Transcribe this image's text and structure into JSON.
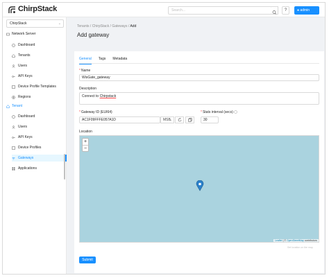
{
  "header": {
    "logo_text": "ChirpStack",
    "search_placeholder": "Search...",
    "help_label": "?",
    "user_label": "admin"
  },
  "sidebar": {
    "tenant_value": "ChirpStack",
    "network_server": {
      "label": "Network Server",
      "items": [
        {
          "label": "Dashboard"
        },
        {
          "label": "Tenants"
        },
        {
          "label": "Users"
        },
        {
          "label": "API Keys"
        },
        {
          "label": "Device Profile Templates"
        },
        {
          "label": "Regions"
        }
      ]
    },
    "tenant": {
      "label": "Tenant",
      "items": [
        {
          "label": "Dashboard"
        },
        {
          "label": "Users"
        },
        {
          "label": "API Keys"
        },
        {
          "label": "Device Profiles"
        },
        {
          "label": "Gateways"
        },
        {
          "label": "Applications"
        }
      ]
    }
  },
  "breadcrumb": {
    "items": [
      "Tenants",
      "ChirpStack",
      "Gateways",
      "Add"
    ],
    "separator": "/"
  },
  "page_title": "Add gateway",
  "tabs": [
    {
      "label": "General",
      "active": true
    },
    {
      "label": "Tags",
      "active": false
    },
    {
      "label": "Metadata",
      "active": false
    }
  ],
  "form": {
    "name_label": "Name",
    "name_value": "WisGate_gateway",
    "description_label": "Description",
    "description_prefix": "Connect to ",
    "description_word": "Chirpstack",
    "gateway_id_label": "Gateway ID (EUI64)",
    "gateway_id_value": "AC1F09FFFE057A1D",
    "byte_order": "MSB",
    "stats_label": "Stats interval (secs)",
    "stats_value": "30",
    "location_label": "Location",
    "zoom_in": "+",
    "zoom_out": "−",
    "attribution_leaflet": "Leaflet",
    "attribution_sep": " | © ",
    "attribution_osm": "OpenStreetMap",
    "attribution_suffix": " contributors",
    "map_hint": "Set location on the map",
    "submit_label": "Submit"
  },
  "colors": {
    "primary": "#1890ff",
    "map_water": "#aad3df",
    "required": "#ff4d4f"
  }
}
